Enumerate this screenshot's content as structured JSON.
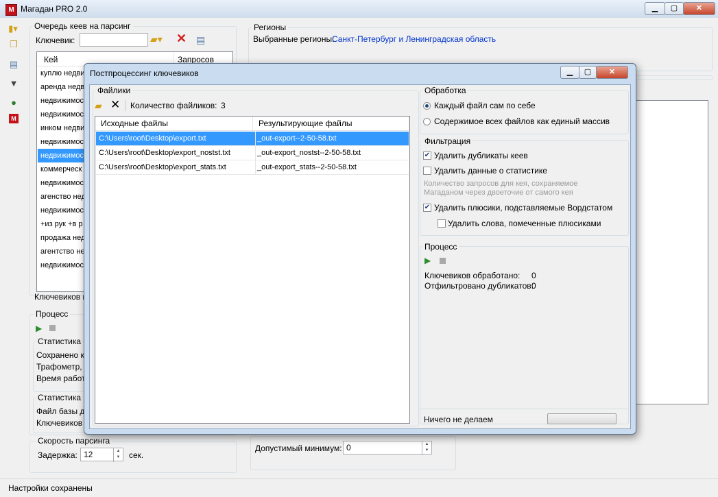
{
  "window": {
    "title": "Магадан PRO 2.0",
    "icon_text": "M"
  },
  "toolbar_icons": [
    "folder-dropdown-icon",
    "copy-icon",
    "settings-icon",
    "filter-icon",
    "globe-icon",
    "magadan-logo-icon"
  ],
  "queue": {
    "title": "Очередь кеев на парсинг",
    "keyword_label": "Ключевик:",
    "keyword_value": "",
    "columns": [
      "Кей",
      "Запросов"
    ],
    "rows": [
      "куплю недви",
      "аренда недв",
      "недвижимос",
      "недвижимос",
      "инком недви",
      "недвижимос",
      "недвижимос",
      "коммерческ",
      "недвижимос",
      "агенство нед",
      "недвижимос",
      "+из рук +в р",
      "продажа нед",
      "агентство не",
      "недвижимос"
    ],
    "selected_row": 6,
    "footer": "Ключевиков в"
  },
  "process_left": {
    "title": "Процесс",
    "stats_title": "Статистика о",
    "stats_lines": [
      "Сохранено кл",
      "Трафометр, к",
      "Время работ"
    ],
    "db_title": "Статистика б",
    "db_lines": [
      "Файл базы д",
      "Ключевиков"
    ]
  },
  "speed": {
    "title": "Скорость парсинга",
    "delay_label": "Задержка:",
    "delay_value": "12",
    "unit": "сек."
  },
  "regions": {
    "title": "Регионы",
    "selected_label": "Выбранные регионы:",
    "selected_value": "Санкт-Петербург и Ленинградская область",
    "link_color": "#0033cc"
  },
  "minimum": {
    "label": "Допустимый минимум:",
    "value": "0"
  },
  "status": "Настройки сохранены",
  "dialog": {
    "title": "Постпроцессинг ключевиков",
    "files": {
      "title": "Файлики",
      "count_label": "Количество файликов:",
      "count_value": "3",
      "columns": [
        "Исходные файлы",
        "Результирующие файлы"
      ],
      "rows": [
        {
          "src": "C:\\Users\\root\\Desktop\\export.txt",
          "dst": "_out-export--2-50-58.txt"
        },
        {
          "src": "C:\\Users\\root\\Desktop\\export_nostst.txt",
          "dst": "_out-export_nostst--2-50-58.txt"
        },
        {
          "src": "C:\\Users\\root\\Desktop\\export_stats.txt",
          "dst": "_out-export_stats--2-50-58.txt"
        }
      ]
    },
    "processing": {
      "title": "Обработка",
      "option1": "Каждый файл сам по себе",
      "option2": "Содержимое всех файлов как единый массив",
      "selected": 1
    },
    "filter": {
      "title": "Фильтрация",
      "dedupe": "Удалить дубликаты кеев",
      "dedupe_checked": true,
      "remove_stats": "Удалить данные о статистике",
      "remove_stats_checked": false,
      "hint1": "Количество запросов для кея, сохраняемое",
      "hint2": "Магаданом через двоеточие от самого кея",
      "remove_plus": "Удалить плюсики, подставляемые Вордстатом",
      "remove_plus_checked": true,
      "remove_words": "Удалить слова, помеченные плюсиками",
      "remove_words_checked": false
    },
    "process": {
      "title": "Процесс",
      "processed_label": "Ключевиков обработано:",
      "processed_value": "0",
      "dupes_label": "Отфильтровано дубликатов:",
      "dupes_value": "0"
    },
    "status": "Ничего не делаем",
    "progress": 0
  }
}
